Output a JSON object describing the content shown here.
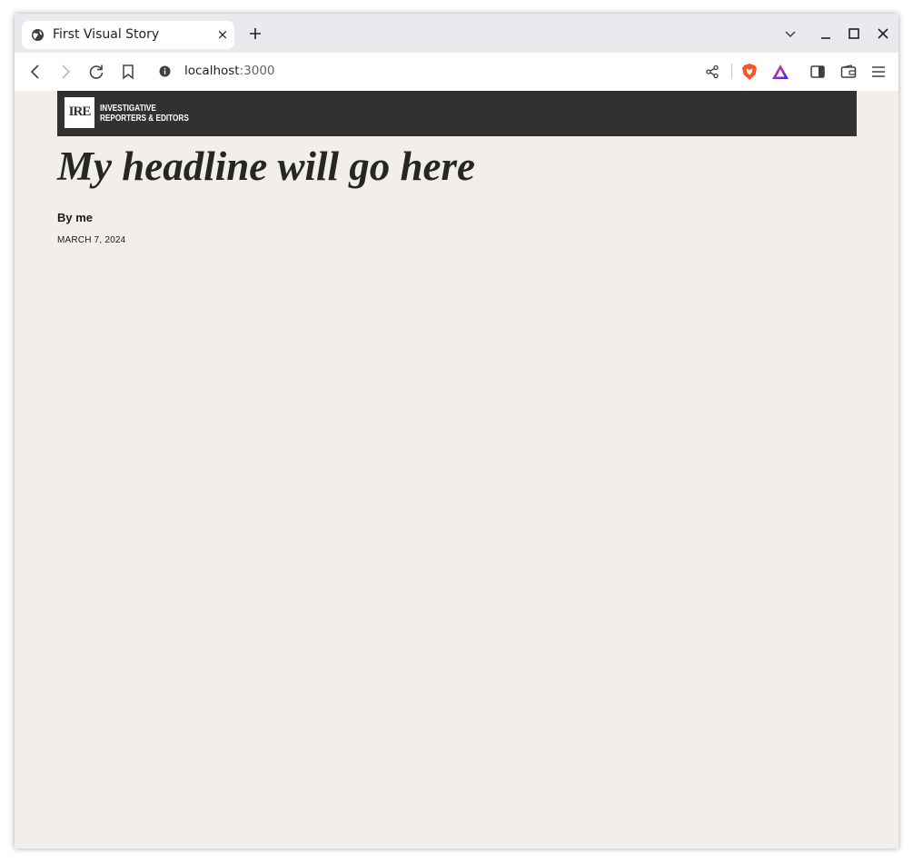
{
  "browser": {
    "tab": {
      "title": "First Visual Story",
      "favicon": "globe-icon",
      "close": "×"
    },
    "new_tab_icon": "plus-icon",
    "window_controls": [
      "chevron-down-icon",
      "minimize-icon",
      "maximize-icon",
      "close-icon"
    ],
    "toolbar": {
      "back_icon": "back-arrow-icon",
      "forward_icon": "forward-arrow-icon",
      "reload_icon": "reload-icon",
      "bookmark_icon": "bookmark-icon",
      "url_host": "localhost",
      "url_port": ":3000",
      "share_icon": "share-icon",
      "brave_shields_icon": "brave-shields-icon",
      "brave_rewards_icon": "brave-rewards-icon",
      "sidebar_icon": "sidebar-icon",
      "wallet_icon": "wallet-icon",
      "menu_icon": "hamburger-menu-icon"
    }
  },
  "page": {
    "masthead": {
      "logo_text": "IRE",
      "name_line1": "INVESTIGATIVE",
      "name_line2": "REPORTERS & EDITORS"
    },
    "headline": "My headline will go here",
    "byline": "By me",
    "date": "MARCH 7, 2024"
  },
  "colors": {
    "page_background": "#f2eee9",
    "masthead_background": "#333031",
    "brave_orange": "#fb542b",
    "rewards_purple": "#6b2ad8"
  }
}
